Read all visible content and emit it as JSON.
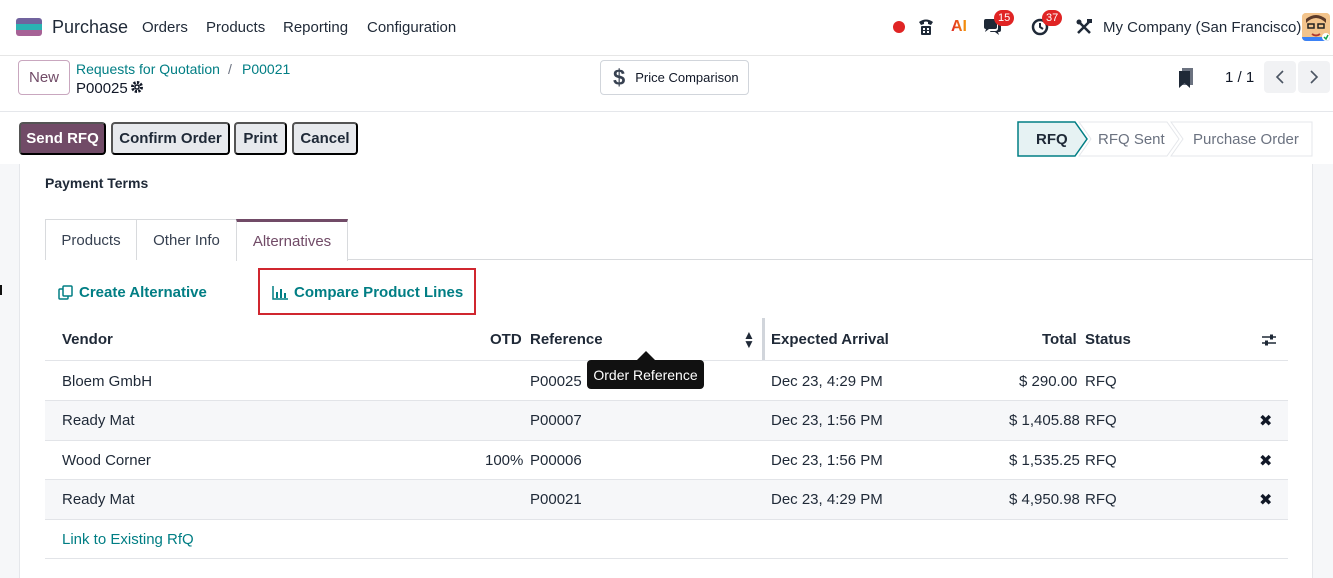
{
  "navbar": {
    "app_name": "Purchase",
    "menu": [
      "Orders",
      "Products",
      "Reporting",
      "Configuration"
    ],
    "messages_count": "15",
    "activities_count": "37",
    "ai_label": "AI",
    "company": "My Company (San Francisco)"
  },
  "control_panel": {
    "new_label": "New",
    "breadcrumb": [
      "Requests for Quotation",
      "P00021"
    ],
    "record_name": "P00025",
    "price_comparison_label": "Price Comparison",
    "pager": "1 / 1"
  },
  "actions": {
    "send_rfq": "Send RFQ",
    "confirm_order": "Confirm Order",
    "print": "Print",
    "cancel": "Cancel"
  },
  "statusbar": {
    "stages": [
      "RFQ",
      "RFQ Sent",
      "Purchase Order"
    ],
    "current": "RFQ"
  },
  "form": {
    "payment_terms_label": "Payment Terms",
    "tabs": [
      "Products",
      "Other Info",
      "Alternatives"
    ],
    "active_tab": "Alternatives"
  },
  "alternatives": {
    "create_alternative": "Create Alternative",
    "compare_product_lines": "Compare Product Lines",
    "columns": [
      "Vendor",
      "OTD",
      "Reference",
      "Expected Arrival",
      "Total",
      "Status"
    ],
    "rows": [
      {
        "vendor": "Bloem GmbH",
        "otd": "",
        "reference": "P00025",
        "expected_arrival": "Dec 23, 4:29 PM",
        "total": "$ 290.00",
        "status": "RFQ"
      },
      {
        "vendor": "Ready Mat",
        "otd": "",
        "reference": "P00007",
        "expected_arrival": "Dec 23, 1:56 PM",
        "total": "$ 1,405.88",
        "status": "RFQ"
      },
      {
        "vendor": "Wood Corner",
        "otd": "100%",
        "reference": "P00006",
        "expected_arrival": "Dec 23, 1:56 PM",
        "total": "$ 1,535.25",
        "status": "RFQ"
      },
      {
        "vendor": "Ready Mat",
        "otd": "",
        "reference": "P00021",
        "expected_arrival": "Dec 23, 4:29 PM",
        "total": "$ 4,950.98",
        "status": "RFQ"
      }
    ],
    "tooltip": "Order Reference",
    "link_existing": "Link to Existing RfQ"
  },
  "colors": {
    "primary": "#714b67",
    "link": "#017e84",
    "highlight_box": "#d0262f",
    "badge": "#e02424"
  }
}
